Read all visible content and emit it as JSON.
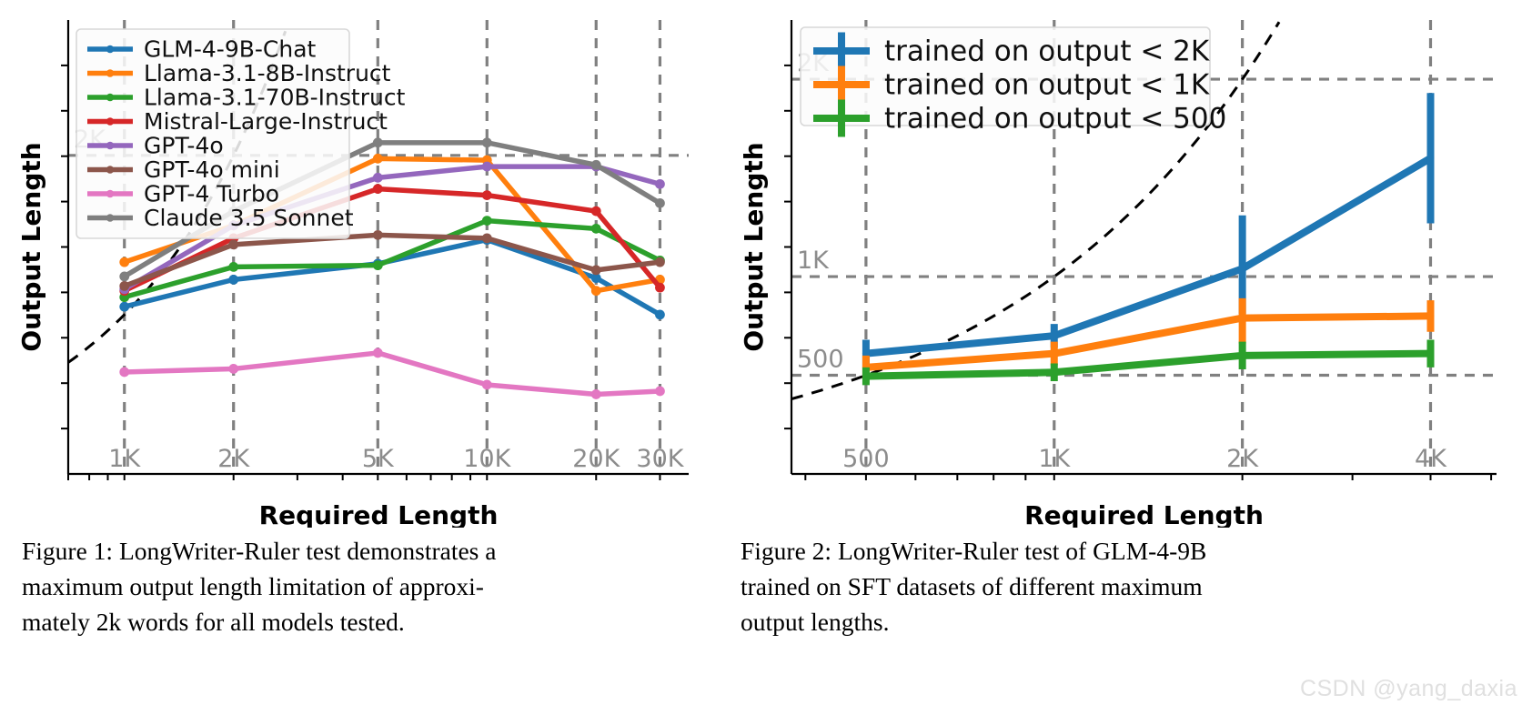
{
  "watermark": {
    "text": "CSDN @yang_daxia"
  },
  "figure1": {
    "caption_label": "Figure 1:",
    "caption_lines": [
      "Figure 1: LongWriter-Ruler test demonstrates a",
      "maximum output length limitation of approxi-",
      "mately 2k words for all models tested."
    ],
    "caption_full": "Figure 1: LongWriter-Ruler test demonstrates a maximum output length limitation of approximately 2k words for all models tested."
  },
  "figure2": {
    "caption_label": "Figure 2:",
    "caption_lines": [
      "Figure 2: LongWriter-Ruler test of GLM-4-9B",
      "trained on SFT datasets of different maximum",
      "output lengths."
    ],
    "caption_full": "Figure 2: LongWriter-Ruler test of GLM-4-9B trained on SFT datasets of different maximum output lengths."
  },
  "chart_data": [
    {
      "id": "chart1",
      "type": "line",
      "title": "",
      "xlabel": "Required Length",
      "ylabel": "Output Length",
      "xscale": "log",
      "xlim": [
        700,
        36000
      ],
      "ylim": [
        0,
        2850
      ],
      "grid": true,
      "legend_position": "upper-left",
      "x": [
        1000,
        2000,
        5000,
        10000,
        20000,
        30000
      ],
      "xtick_labels": [
        "1K",
        "2K",
        "5K",
        "10K",
        "20K",
        "30K"
      ],
      "ytick_values": [
        2000
      ],
      "ytick_labels": [
        "2K"
      ],
      "diagonal_reference": true,
      "series": [
        {
          "name": "GLM-4-9B-Chat",
          "color": "#1f77b4",
          "values": [
            1050,
            1220,
            1320,
            1470,
            1230,
            1000
          ]
        },
        {
          "name": "Llama-3.1-8B-Instruct",
          "color": "#ff7f0e",
          "values": [
            1330,
            1560,
            1980,
            1970,
            1150,
            1220
          ]
        },
        {
          "name": "Llama-3.1-70B-Instruct",
          "color": "#2ca02c",
          "values": [
            1110,
            1300,
            1310,
            1590,
            1540,
            1340
          ]
        },
        {
          "name": "Mistral-Large-Instruct",
          "color": "#d62728",
          "values": [
            1150,
            1480,
            1790,
            1750,
            1650,
            1170
          ]
        },
        {
          "name": "GPT-4o",
          "color": "#9467bd",
          "values": [
            1160,
            1560,
            1860,
            1930,
            1930,
            1820
          ]
        },
        {
          "name": "GPT-4o mini",
          "color": "#8c564b",
          "values": [
            1180,
            1440,
            1500,
            1480,
            1280,
            1330
          ]
        },
        {
          "name": "GPT-4 Turbo",
          "color": "#e377c2",
          "values": [
            640,
            660,
            760,
            560,
            500,
            520
          ]
        },
        {
          "name": "Claude 3.5 Sonnet",
          "color": "#7f7f7f",
          "values": [
            1240,
            1650,
            2080,
            2080,
            1940,
            1700
          ]
        }
      ]
    },
    {
      "id": "chart2",
      "type": "line",
      "title": "",
      "xlabel": "Required Length",
      "ylabel": "Output Length",
      "xscale": "log",
      "xlim": [
        380,
        5100
      ],
      "ylim": [
        0,
        2300
      ],
      "grid": true,
      "legend_position": "upper-left",
      "errorbars": true,
      "x": [
        500,
        1000,
        2000,
        4000
      ],
      "xtick_labels": [
        "500",
        "1K",
        "2K",
        "4K"
      ],
      "ytick_values": [
        500,
        1000,
        2000
      ],
      "ytick_labels": [
        "500",
        "1K",
        "2K"
      ],
      "diagonal_reference": true,
      "series": [
        {
          "name": "trained on output < 2K",
          "color": "#1f77b4",
          "values": [
            610,
            700,
            1040,
            1600
          ],
          "err_low": [
            70,
            60,
            230,
            330
          ],
          "err_high": [
            70,
            60,
            270,
            330
          ]
        },
        {
          "name": "trained on output < 1K",
          "color": "#ff7f0e",
          "values": [
            540,
            610,
            790,
            800
          ],
          "err_low": [
            60,
            60,
            130,
            80
          ],
          "err_high": [
            60,
            60,
            100,
            80
          ]
        },
        {
          "name": "trained on output < 500",
          "color": "#2ca02c",
          "values": [
            495,
            515,
            600,
            610
          ],
          "err_low": [
            45,
            45,
            70,
            70
          ],
          "err_high": [
            45,
            45,
            70,
            70
          ]
        }
      ]
    }
  ]
}
